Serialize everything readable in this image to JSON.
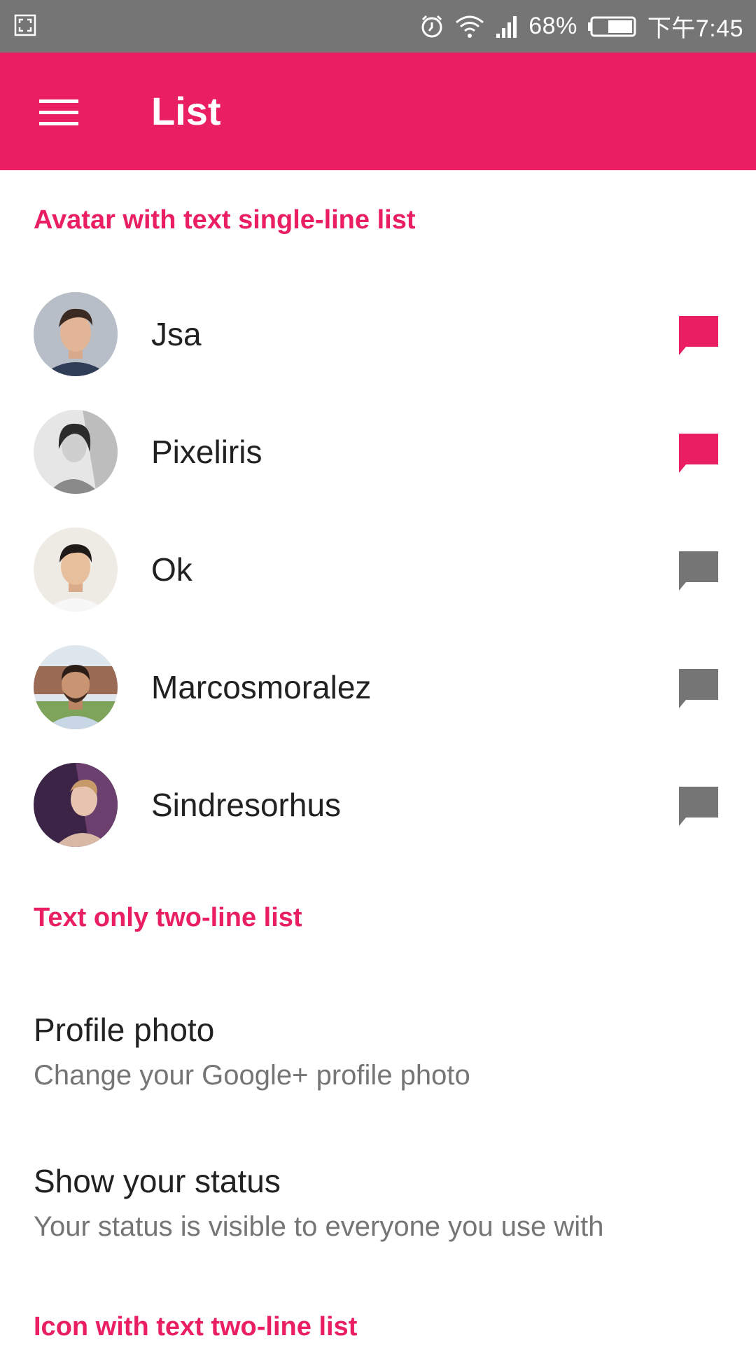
{
  "status_bar": {
    "battery": "68%",
    "time": "下午7:45",
    "icons": [
      "screenshot-icon",
      "alarm-icon",
      "wifi-icon",
      "signal-icon",
      "battery-icon"
    ]
  },
  "app_bar": {
    "title": "List",
    "icons": [
      "menu-icon"
    ]
  },
  "colors": {
    "primary": "#E91E63",
    "status_bar": "#757575",
    "active_chat": "#E91E63",
    "inactive_chat": "#757575"
  },
  "sections": {
    "avatar_list": {
      "header": "Avatar with text single-line list",
      "items": [
        {
          "name": "Jsa",
          "chat_active": true
        },
        {
          "name": "Pixeliris",
          "chat_active": true
        },
        {
          "name": "Ok",
          "chat_active": false
        },
        {
          "name": "Marcosmoralez",
          "chat_active": false
        },
        {
          "name": "Sindresorhus",
          "chat_active": false
        }
      ]
    },
    "two_line_list": {
      "header": "Text only two-line list",
      "items": [
        {
          "primary": "Profile photo",
          "secondary": "Change your Google+ profile photo"
        },
        {
          "primary": "Show your status",
          "secondary": "Your status is visible to everyone you use with"
        }
      ]
    },
    "icon_list": {
      "header": "Icon with text two-line list"
    }
  }
}
